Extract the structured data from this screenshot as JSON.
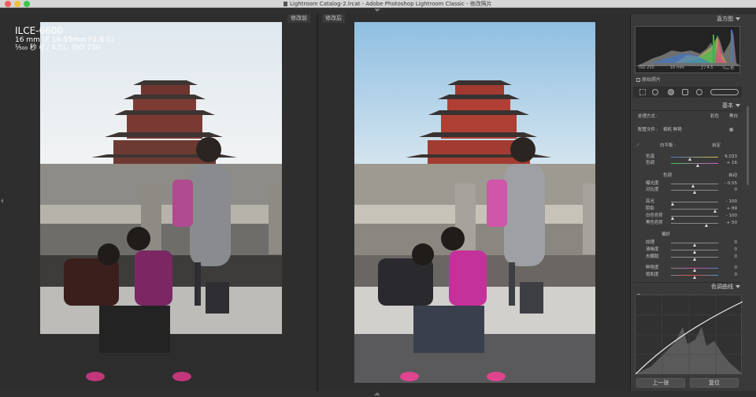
{
  "window": {
    "title": "Lightroom Catalog-2.lrcat - Adobe Photoshop Lightroom Classic - 修改照片"
  },
  "compare": {
    "before_label": "修改前",
    "after_label": "修改后",
    "overlay": {
      "model": "ILCE-6600",
      "lens": "16 mm (E 16-55mm F2.8 G)",
      "exposure": "¹⁄₅₀₀ 秒 (ƒ / 4.5)，ISO 250"
    }
  },
  "panel": {
    "histogram": {
      "title": "直方图",
      "iso": "ISO 250",
      "focal": "16 mm",
      "aperture": "ƒ / 4.5",
      "shutter": "¹⁄₅₀₀ 秒",
      "original_photo": "原始照片"
    },
    "basic": {
      "title": "基本",
      "treatment_label": "处理方式 :",
      "color": "彩色",
      "bw": "黑白",
      "profile_label": "配置文件 :",
      "profile_value": "相机 鲜艳",
      "wb_label": "白平衡 :",
      "wb_value": "自定",
      "temp_label": "色温",
      "temp_value": "6,033",
      "tint_label": "色调",
      "tint_value": "+ 16",
      "tone_label": "色调",
      "auto": "自动",
      "exposure_label": "曝光度",
      "exposure_value": "- 0.55",
      "contrast_label": "对比度",
      "contrast_value": "0",
      "highlights_label": "高光",
      "highlights_value": "- 100",
      "shadows_label": "阴影",
      "shadows_value": "+ 89",
      "whites_label": "白色色阶",
      "whites_value": "- 100",
      "blacks_label": "黑色色阶",
      "blacks_value": "+ 50",
      "presence_label": "偏好",
      "texture_label": "纹理",
      "texture_value": "0",
      "clarity_label": "清晰度",
      "clarity_value": "0",
      "dehaze_label": "去朦胧",
      "dehaze_value": "0",
      "vibrance_label": "鲜艳度",
      "vibrance_value": "0",
      "saturation_label": "饱和度",
      "saturation_value": "0"
    },
    "tone_curve": {
      "title": "色调曲线"
    },
    "buttons": {
      "previous": "上一张",
      "reset": "复位"
    }
  }
}
